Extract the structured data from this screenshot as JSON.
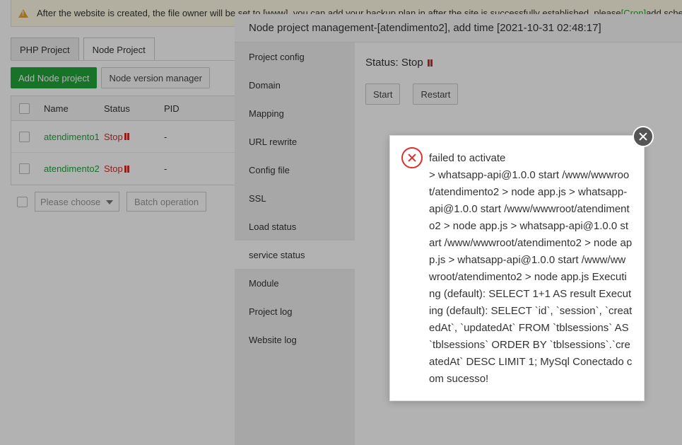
{
  "notice": {
    "text_before": "After the website is created, the file owner will be set to [www], you can add your backup plan in after the site is successfully established, please",
    "cron_link": "[Cron]",
    "text_after": "add scheduled"
  },
  "tabs": [
    "PHP Project",
    "Node Project"
  ],
  "toolbar": {
    "add_label": "Add Node project",
    "version_label": "Node version manager"
  },
  "table": {
    "headers": {
      "name": "Name",
      "status": "Status",
      "pid": "PID"
    },
    "rows": [
      {
        "name": "atendimento1",
        "status": "Stop",
        "pid": "-"
      },
      {
        "name": "atendimento2",
        "status": "Stop",
        "pid": "-"
      }
    ]
  },
  "footer": {
    "select_placeholder": "Please choose",
    "batch_label": "Batch operation"
  },
  "panel": {
    "title": "Node project management-[atendimento2], add time [2021-10-31 02:48:17]",
    "menu": [
      "Project config",
      "Domain",
      "Mapping",
      "URL rewrite",
      "Config file",
      "SSL",
      "Load status",
      "service status",
      "Module",
      "Project log",
      "Website log"
    ],
    "active_menu_index": 7,
    "status_text": "Status: Stop",
    "start_label": "Start",
    "restart_label": "Restart"
  },
  "dialog": {
    "message_title": "failed to activate",
    "message_body": "> whatsapp-api@1.0.0 start /www/wwwroot/atendimento2 > node app.js > whatsapp-api@1.0.0 start /www/wwwroot/atendimento2 > node app.js > whatsapp-api@1.0.0 start /www/wwwroot/atendimento2 > node app.js > whatsapp-api@1.0.0 start /www/wwwroot/atendimento2 > node app.js Executing (default): SELECT 1+1 AS result Executing (default): SELECT `id`, `session`, `createdAt`, `updatedAt` FROM `tblsessions` AS `tblsessions` ORDER BY `tblsessions`.`createdAt` DESC LIMIT 1; MySql Conectado com sucesso!"
  },
  "colors": {
    "accent": "#20a53a",
    "stop": "#c9302c",
    "error": "#e02d2d"
  }
}
